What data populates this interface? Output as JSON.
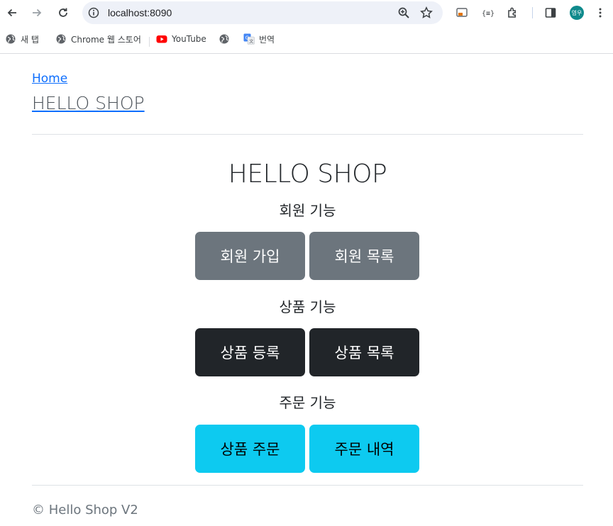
{
  "browser": {
    "url": "localhost:8090",
    "bookmarks": [
      {
        "label": "새 탭",
        "icon": "globe-icon"
      },
      {
        "label": "Chrome 웹 스토어",
        "icon": "globe-icon"
      },
      {
        "label": "YouTube",
        "icon": "youtube-icon"
      },
      {
        "label": "",
        "icon": "globe-icon"
      },
      {
        "label": "번역",
        "icon": "google-translate-icon"
      }
    ],
    "profile_initials": "영우",
    "colors": {
      "omnibox_bg": "#eef1f8",
      "avatar_bg": "#0f8a8c"
    }
  },
  "header": {
    "home_link": "Home",
    "brand_link": "HELLO SHOP"
  },
  "main": {
    "title": "HELLO SHOP",
    "sections": [
      {
        "label": "회원 기능",
        "buttons": [
          {
            "label": "회원 가입"
          },
          {
            "label": "회원 목록"
          }
        ],
        "style": "secondary"
      },
      {
        "label": "상품 기능",
        "buttons": [
          {
            "label": "상품 등록"
          },
          {
            "label": "상품 목록"
          }
        ],
        "style": "dark"
      },
      {
        "label": "주문 기능",
        "buttons": [
          {
            "label": "상품 주문"
          },
          {
            "label": "주문 내역"
          }
        ],
        "style": "info"
      }
    ]
  },
  "footer": {
    "text": "© Hello Shop V2"
  },
  "colors": {
    "link": "#0d6efd",
    "secondary": "#6c757d",
    "dark": "#212529",
    "info": "#0dcaf0"
  }
}
